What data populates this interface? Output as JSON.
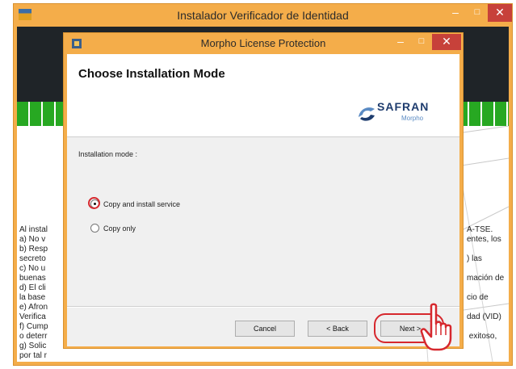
{
  "outer_window": {
    "title": "Instalador Verificador de Identidad",
    "min_glyph": "–",
    "max_glyph": "□",
    "close_glyph": "✕",
    "bg_text_left": "Al instal\na) No v\nb) Resp\nsecreto\nc) No u\nbuenas\nd) El cli\nla base\ne) Afron\nVerifica\nf) Cump\no deterr\ng) Solic\npor tal r",
    "bg_text_right": "A-TSE.\nentes, los\n\n) las\n\nmación de\n\ncio de\n\ndad (VID)\n\n exitoso,"
  },
  "inner_window": {
    "title": "Morpho License Protection",
    "min_glyph": "–",
    "max_glyph": "□",
    "close_glyph": "✕",
    "heading": "Choose Installation Mode",
    "logo_brand": "SAFRAN",
    "logo_sub": "Morpho",
    "mode_label": "Installation mode :",
    "options": [
      {
        "label": "Copy and install service",
        "checked": true
      },
      {
        "label": "Copy only",
        "checked": false
      }
    ],
    "buttons": {
      "cancel": "Cancel",
      "back": "< Back",
      "next": "Next >"
    }
  },
  "colors": {
    "window_frame": "#f4ad4a",
    "close_button": "#c7413a",
    "highlight": "#d6282e",
    "safran_blue": "#1e3c6e"
  },
  "icons": [
    "app-icon",
    "safran-logo",
    "pointer-hand-icon"
  ]
}
